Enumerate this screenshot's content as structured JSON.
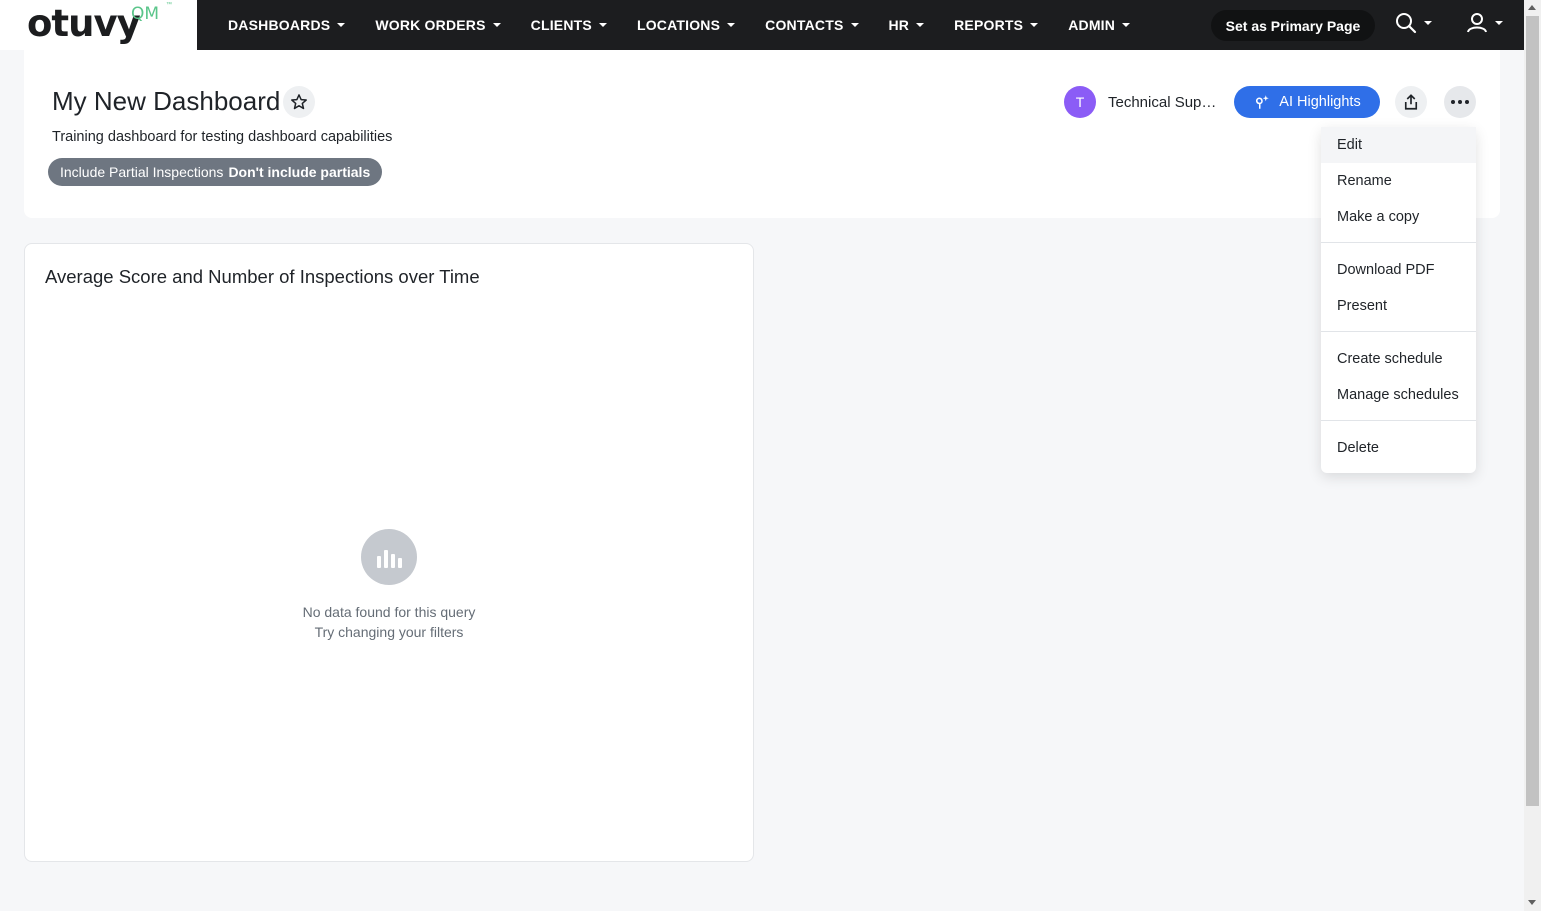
{
  "brand": {
    "logo_text": "otuvy",
    "logo_suffix": "QM",
    "trademark": "™"
  },
  "nav": {
    "items": [
      {
        "label": "DASHBOARDS"
      },
      {
        "label": "WORK ORDERS"
      },
      {
        "label": "CLIENTS"
      },
      {
        "label": "LOCATIONS"
      },
      {
        "label": "CONTACTS"
      },
      {
        "label": "HR"
      },
      {
        "label": "REPORTS"
      },
      {
        "label": "ADMIN"
      }
    ],
    "primary_button": "Set as Primary Page",
    "icons": [
      "search-icon",
      "user-icon"
    ]
  },
  "dashboard": {
    "title": "My New Dashboard",
    "description": "Training dashboard for testing dashboard capabilities",
    "filter": {
      "name": "Include Partial Inspections",
      "value": "Don't include partials"
    },
    "owner": {
      "initial": "T",
      "name": "Technical Support"
    },
    "ai_button": "AI Highlights",
    "colors": {
      "accent": "#2f6fe8",
      "avatar": "#8b5cf6",
      "nav_bg": "#1c1d1f",
      "logo_green": "#5ac58a"
    }
  },
  "widget": {
    "title": "Average Score and Number of Inspections over Time",
    "empty_message": "No data found for this query",
    "empty_hint": "Try changing your filters"
  },
  "menu": {
    "items": [
      {
        "label": "Edit"
      },
      {
        "label": "Rename"
      },
      {
        "label": "Make a copy"
      },
      {
        "label": "Download PDF"
      },
      {
        "label": "Present"
      },
      {
        "label": "Create schedule"
      },
      {
        "label": "Manage schedules"
      },
      {
        "label": "Delete"
      }
    ]
  }
}
